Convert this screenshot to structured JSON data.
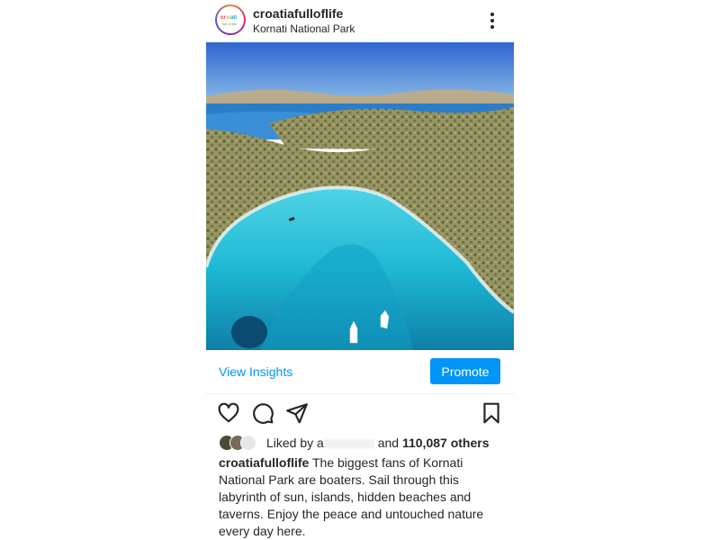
{
  "post": {
    "username": "croatiafulloflife",
    "location": "Kornati National Park",
    "avatar_icon": "croatia-full-of-life-logo",
    "more_icon": "more-vertical-icon",
    "photo_alt": "Aerial view of a turquoise bay in Kornati National Park",
    "insights_label": "View Insights",
    "promote_label": "Promote",
    "actions": {
      "like_icon": "heart-icon",
      "comment_icon": "comment-icon",
      "share_icon": "send-icon",
      "save_icon": "bookmark-icon"
    },
    "likes": {
      "prefix": "Liked by a",
      "and": "and",
      "count": "110,087 others"
    },
    "caption": {
      "author": "croatiafulloflife",
      "text": "The biggest fans of Kornati National Park are boaters. Sail through this labyrinth of sun, islands, hidden beaches and taverns. Enjoy the peace and untouched nature every day here."
    }
  },
  "colors": {
    "accent_blue": "#0095f6",
    "text": "#262626",
    "sea_turquoise": "#1fb8d4"
  }
}
